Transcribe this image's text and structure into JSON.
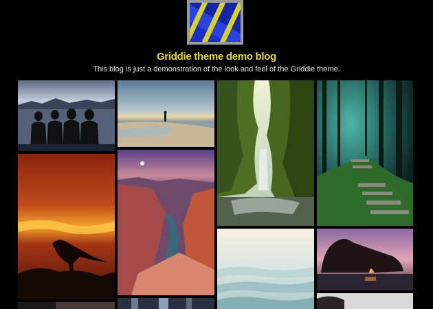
{
  "site": {
    "title": "Griddie theme demo blog",
    "tagline": "This blog is just a demonstration of the look and feel of the Griddie theme."
  },
  "logo_icon": "abstract-blue-yellow-logo",
  "posts": [
    {
      "name": "post-thumbnail-friends-at-lake"
    },
    {
      "name": "post-thumbnail-person-on-beach"
    },
    {
      "name": "post-thumbnail-mossy-canyon"
    },
    {
      "name": "post-thumbnail-forest-steps"
    },
    {
      "name": "post-thumbnail-bird-at-sunset"
    },
    {
      "name": "post-thumbnail-grand-canyon"
    },
    {
      "name": "post-thumbnail-misty-hills"
    },
    {
      "name": "post-thumbnail-rock-arch-sunset"
    },
    {
      "name": "post-thumbnail-partial-dark"
    },
    {
      "name": "post-thumbnail-partial-city"
    },
    {
      "name": "post-thumbnail-partial-rock"
    }
  ]
}
